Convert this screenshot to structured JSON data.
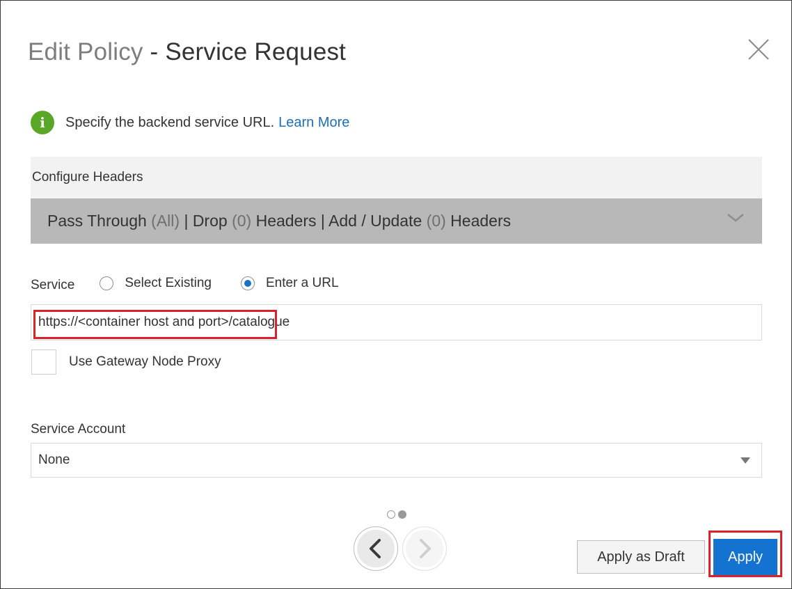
{
  "dialog": {
    "title_prefix": "Edit Policy",
    "title_suffix": " - Service Request",
    "close_icon": "close-icon"
  },
  "info": {
    "icon": "info-icon",
    "icon_glyph": "i",
    "text": "Specify the backend service URL.",
    "link": "Learn More"
  },
  "headers": {
    "label": "Configure Headers",
    "parts": [
      "Pass Through ",
      "(All)",
      " | Drop ",
      "(0)",
      " Headers | Add / Update ",
      "(0)",
      " Headers"
    ],
    "chevron_icon": "chevron-down-icon"
  },
  "service": {
    "label": "Service",
    "options": [
      {
        "label": "Select Existing",
        "checked": false
      },
      {
        "label": "Enter a URL",
        "checked": true
      }
    ],
    "url_value": "https://<container host and port>/catalogue"
  },
  "gateway_proxy": {
    "label": "Use Gateway Node Proxy",
    "checked": false
  },
  "service_account": {
    "label": "Service Account",
    "selected": "None"
  },
  "pager": {
    "pages": 2,
    "current": 2
  },
  "buttons": {
    "draft": "Apply as Draft",
    "apply": "Apply"
  },
  "colors": {
    "accent": "#1473d1",
    "highlight": "#d9232a",
    "info_green": "#5aa626",
    "link": "#1d6fb8"
  }
}
